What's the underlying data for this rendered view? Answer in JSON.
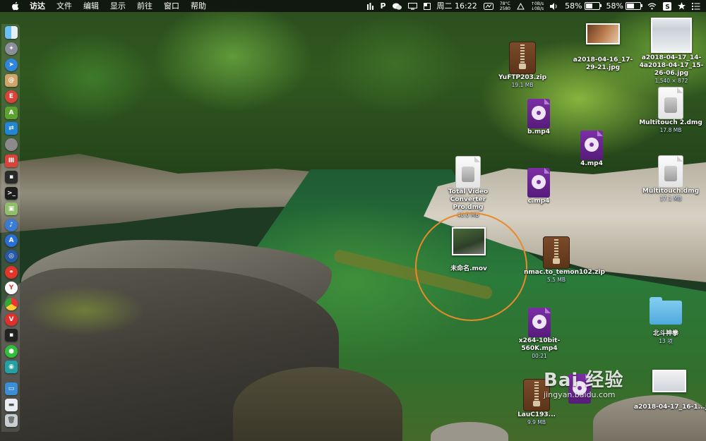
{
  "menubar": {
    "app_name": "访达",
    "menus": [
      "文件",
      "编辑",
      "显示",
      "前往",
      "窗口",
      "帮助"
    ],
    "status": {
      "temperature": "78°C",
      "fan_rpm": "2580",
      "net_up": "↑0B/s",
      "net_down": "↓0B/s",
      "battery_1": "58%",
      "battery_1_level": 0.58,
      "battery_2": "58%",
      "battery_2_level": 0.58,
      "clock": "周二 16:22"
    }
  },
  "dock": {
    "items": [
      "finder",
      "launchpad",
      "safari",
      "contacts",
      "app-red",
      "android-studio",
      "teamviewer",
      "app-gray",
      "app-red-2",
      "terminal",
      "terminal-2",
      "preview",
      "siri",
      "app-store",
      "app-blue",
      "weibo",
      "yandex",
      "chrome",
      "vivaldi",
      "terminal-3",
      "wechat",
      "app-teal",
      "screen-share",
      "desktop",
      "trash"
    ]
  },
  "desktop": {
    "items": [
      {
        "name": "YuFTP203.zip",
        "size": "19.1 MB",
        "kind": "zip"
      },
      {
        "name": "b.mp4",
        "size": "",
        "kind": "video"
      },
      {
        "name": "4.mp4",
        "size": "",
        "kind": "video"
      },
      {
        "name": "c.mp4",
        "size": "",
        "kind": "video"
      },
      {
        "name": "Total Video Converter Pro.dmg",
        "size": "40.0 MB",
        "kind": "dmg"
      },
      {
        "name": "未命名.mov",
        "size": "",
        "kind": "mov"
      },
      {
        "name": "nmac.to_temon102.zip",
        "size": "5.5 MB",
        "kind": "zip"
      },
      {
        "name": "x264-10bit-560K.mp4",
        "size": "00:21",
        "kind": "video"
      },
      {
        "name": "LauC193...",
        "size": "9.9 MB",
        "kind": "zip"
      },
      {
        "name": "a2018-04-16_17-29-21.jpg",
        "size": "",
        "kind": "image"
      },
      {
        "name": "a2018-04-17_14-4a2018-04-17_15-26-06.jpg",
        "size": "1,540 × 872",
        "kind": "image"
      },
      {
        "name": "Multitouch 2.dmg",
        "size": "17.8 MB",
        "kind": "dmg"
      },
      {
        "name": "Multitouch.dmg",
        "size": "17.1 MB",
        "kind": "dmg"
      },
      {
        "name": "北斗神拳",
        "size": "13 项",
        "kind": "folder"
      },
      {
        "name": "a2018-04-17_16-1...jpg",
        "size": "",
        "kind": "image"
      }
    ]
  },
  "watermark": {
    "logo": "Bai 经验",
    "url": "jingyan.baidu.com"
  },
  "colors": {
    "highlight": "#e88a2a",
    "folder": "#5bb5e6",
    "video": "#6a2590",
    "zip": "#6b3f22"
  }
}
